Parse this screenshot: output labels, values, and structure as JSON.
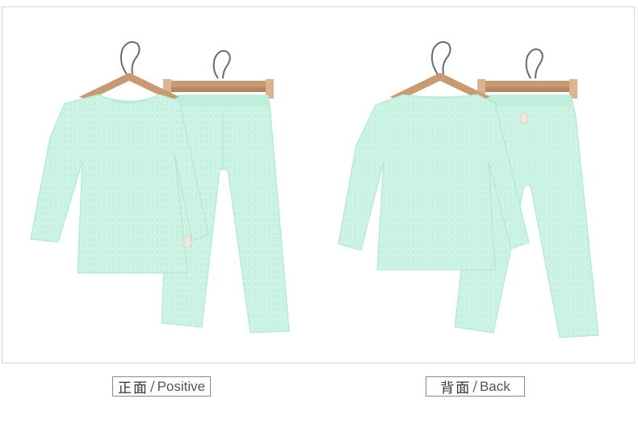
{
  "colors": {
    "garment": "#cdf3e5",
    "garment_shadow": "#a9e6d2",
    "hanger_wood": "#c79a73",
    "hanger_wire": "#6b6b6b",
    "frame_border": "#d4d4d4",
    "caption_border": "#8a8a8a"
  },
  "captions": {
    "front_zh": "正面",
    "front_en": "Positive",
    "back_zh": "背面",
    "back_en": "Back",
    "separator": "/"
  }
}
